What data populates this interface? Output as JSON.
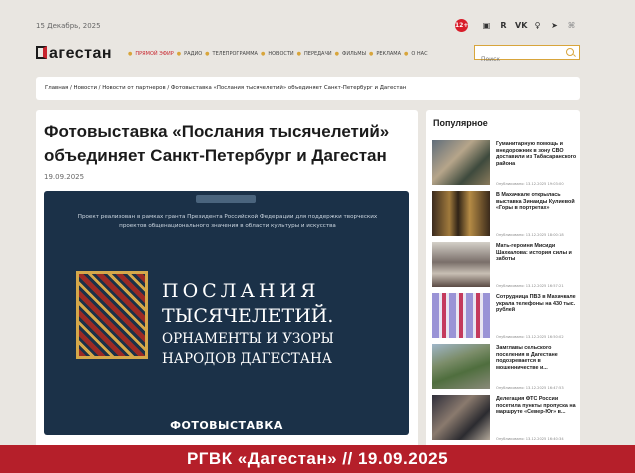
{
  "topbar": {
    "date": "15 Декабрь, 2025",
    "age_badge": "12+",
    "social_icons": [
      "ok-icon",
      "rutube-icon",
      "vk-icon",
      "odnoklassniki-icon",
      "telegram-icon",
      "rss-icon"
    ]
  },
  "header": {
    "logo": "агестан",
    "nav": {
      "live": "прямой эфир",
      "items": [
        "радио",
        "телепрограмма",
        "новости",
        "передачи",
        "фильмы",
        "реклама",
        "о нас"
      ]
    },
    "search": {
      "placeholder": "Поиск"
    }
  },
  "breadcrumbs": "Главная / Новости / Новости от партнеров / Фотовыставка «Послания тысячелетий» объединяет Санкт-Петербург и Дагестан",
  "article": {
    "title": "Фотовыставка «Послания тысячелетий» объединяет Санкт-Петербург и Дагестан",
    "date": "19.09.2025",
    "poster": {
      "description": "Проект реализован в рамках гранта Президента Российской Федерации для поддержки творческих проектов общенационального значения в области культуры и искусства",
      "line1": "ПОСЛАНИЯ",
      "line2": "ТЫСЯЧЕЛЕТИЙ.",
      "line3": "ОРНАМЕНТЫ И УЗОРЫ",
      "line4": "НАРОДОВ ДАГЕСТАНА",
      "footer": "ФОТОВЫСТАВКА"
    }
  },
  "sidebar": {
    "title": "Популярное",
    "items": [
      {
        "text": "Гуманитарную помощь и внедорожник в зону СВО доставили из Табасаранского района",
        "meta": "Опубликовано: 13.12.2025 19:03:00"
      },
      {
        "text": "В Махачкале открылась выставка Зинаиды Кулиевой «Горы в портретах»",
        "meta": "Опубликовано: 13.12.2025 18:00:18"
      },
      {
        "text": "Мать-героиня Мисиди Шахкалова: история силы и заботы",
        "meta": "Опубликовано: 13.12.2025 16:57:21"
      },
      {
        "text": "Сотрудница ПВЗ в Махачкале украла телефоны на 430 тыс. рублей",
        "meta": "Опубликовано: 13.12.2025 16:50:02"
      },
      {
        "text": "Замглавы сельского поселения в Дагестане подозревается в мошенничестве и...",
        "meta": "Опубликовано: 13.12.2025 16:47:53"
      },
      {
        "text": "Делегация ФТС России посетила пункты пропуска на маршруте «Север-Юг» в...",
        "meta": "Опубликовано: 13.12.2025 16:40:34"
      }
    ]
  },
  "banner": "РГВК «Дагестан» // 19.09.2025",
  "colors": {
    "brand_red": "#c8252e",
    "nav_dot": "#d8a53b",
    "poster_bg": "#1b3148",
    "banner": "#b51f2a"
  }
}
